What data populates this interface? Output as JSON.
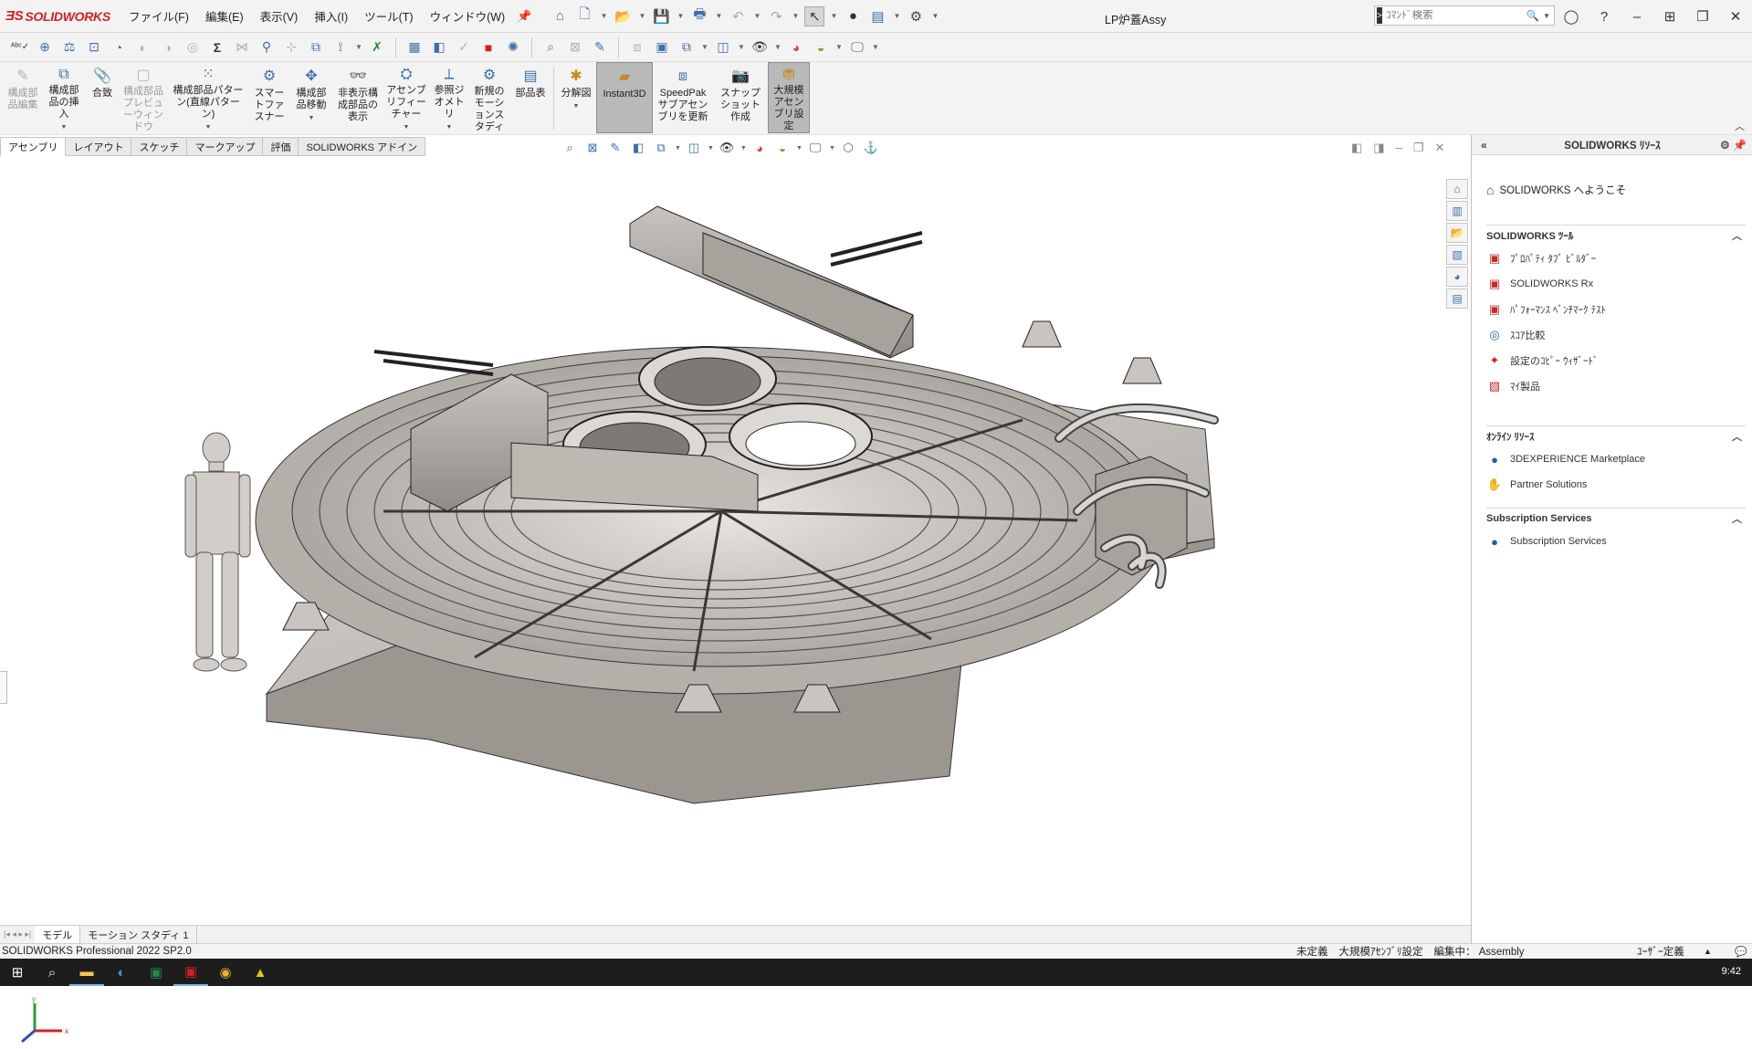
{
  "app": {
    "brand": "SOLIDWORKS",
    "doc_title": "LP炉蓋Assy"
  },
  "menu": [
    "ファイル(F)",
    "編集(E)",
    "表示(V)",
    "挿入(I)",
    "ツール(T)",
    "ウィンドウ(W)"
  ],
  "search": {
    "placeholder": "ｺﾏﾝﾄﾞ検索"
  },
  "ribbon": [
    {
      "label": "構成部品編集",
      "disabled": true,
      "icon": "edit-component-icon"
    },
    {
      "label": "構成部品の挿入",
      "disabled": false,
      "icon": "insert-component-icon"
    },
    {
      "label": "合致",
      "disabled": false,
      "icon": "mate-icon"
    },
    {
      "label": "構成部品プレビューウィンドウ",
      "disabled": true,
      "icon": "preview-window-icon"
    },
    {
      "label": "構成部品パターン(直線パターン)",
      "disabled": false,
      "icon": "linear-pattern-icon"
    },
    {
      "label": "スマートファスナー",
      "disabled": false,
      "icon": "smart-fastener-icon"
    },
    {
      "label": "構成部品移動",
      "disabled": false,
      "icon": "move-component-icon"
    },
    {
      "label": "非表示構成部品の表示",
      "disabled": false,
      "icon": "show-hidden-icon"
    },
    {
      "label": "アセンブリフィーチャー",
      "disabled": false,
      "icon": "assembly-feature-icon"
    },
    {
      "label": "参照ジオメトリ",
      "disabled": false,
      "icon": "reference-geometry-icon"
    },
    {
      "label": "新規のモーションスタディ",
      "disabled": false,
      "icon": "motion-study-icon"
    },
    {
      "label": "部品表",
      "disabled": false,
      "icon": "bom-icon"
    },
    {
      "label": "分解図",
      "disabled": false,
      "icon": "exploded-view-icon"
    },
    {
      "label": "Instant3D",
      "disabled": false,
      "icon": "instant3d-icon",
      "active": true
    },
    {
      "label": "SpeedPak サブアセンブリを更新",
      "disabled": false,
      "icon": "speedpak-icon"
    },
    {
      "label": "スナップショット作成",
      "disabled": false,
      "icon": "snapshot-icon"
    },
    {
      "label": "大規模アセンブリ設定",
      "disabled": false,
      "icon": "large-assembly-icon",
      "active": true
    }
  ],
  "tabs": [
    "アセンブリ",
    "レイアウト",
    "スケッチ",
    "マークアップ",
    "評価",
    "SOLIDWORKS アドイン"
  ],
  "model_tabs": [
    "モデル",
    "モーション スタディ 1"
  ],
  "status": {
    "product": "SOLIDWORKS Professional 2022 SP2.0",
    "definition": "未定義",
    "large_assembly": "大規模ｱｾﾝﾌﾞﾘ設定",
    "editing": "編集中： Assembly",
    "units": "ﾕｰｻﾞｰ定義"
  },
  "taskpane": {
    "title": "SOLIDWORKS ﾘｿｰｽ",
    "welcome": "SOLIDWORKS へようこそ",
    "tools_header": "SOLIDWORKS ﾂｰﾙ",
    "tools": [
      "ﾌﾟﾛﾊﾟﾃｨ ﾀﾌﾞ ﾋﾞﾙﾀﾞｰ",
      "SOLIDWORKS Rx",
      "ﾊﾟﾌｫｰﾏﾝｽ ﾍﾞﾝﾁﾏｰｸ ﾃｽﾄ",
      "ｽｺｱ比較",
      "設定のｺﾋﾟｰ ｳｨｻﾞｰﾄﾞ",
      "ﾏｲ製品"
    ],
    "online_header": "ｵﾝﾗｲﾝ ﾘｿｰｽ",
    "online": [
      "3DEXPERIENCE Marketplace",
      "Partner Solutions"
    ],
    "subs_header": "Subscription Services",
    "subs": [
      "Subscription Services"
    ]
  },
  "taskbar": {
    "clock": "9:42"
  },
  "colors": {
    "brand": "#d32027",
    "accent": "#3d6fa8",
    "model": "#bfbab5"
  }
}
